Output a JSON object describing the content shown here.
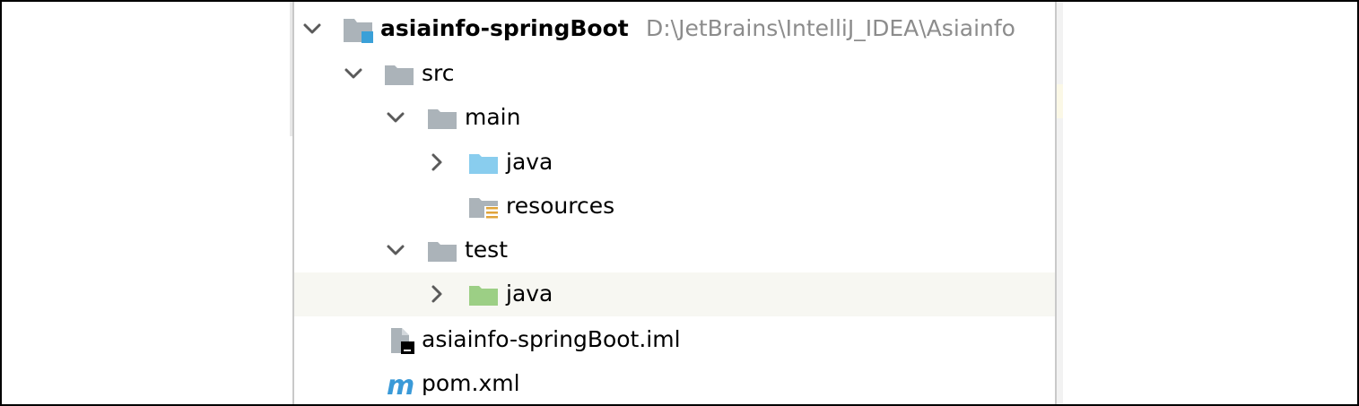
{
  "project_tree": {
    "root": {
      "label": "asiainfo-springBoot",
      "path": "D:\\JetBrains\\IntelliJ_IDEA\\Asiainfo",
      "expanded": true,
      "icon": "module-folder-icon"
    },
    "items": [
      {
        "label": "src",
        "expanded": true,
        "icon": "folder-icon"
      },
      {
        "label": "main",
        "expanded": true,
        "icon": "folder-icon"
      },
      {
        "label": "java",
        "expanded": false,
        "icon": "source-root-folder-icon"
      },
      {
        "label": "resources",
        "icon": "resources-folder-icon"
      },
      {
        "label": "test",
        "expanded": true,
        "icon": "folder-icon"
      },
      {
        "label": "java",
        "expanded": false,
        "icon": "test-source-folder-icon",
        "highlighted": true
      },
      {
        "label": "asiainfo-springBoot.iml",
        "icon": "iml-file-icon"
      },
      {
        "label": "pom.xml",
        "icon": "maven-m-icon"
      }
    ]
  },
  "colors": {
    "folder_gray": "#abb3b9",
    "source_blue": "#89cdee",
    "test_green": "#9ccf85",
    "module_square": "#3aa0d8",
    "resource_lines": "#e0a43a",
    "maven_blue": "#3a9ad8",
    "path_gray": "#8c8c8c",
    "row_highlight": "#f7f7f2"
  }
}
